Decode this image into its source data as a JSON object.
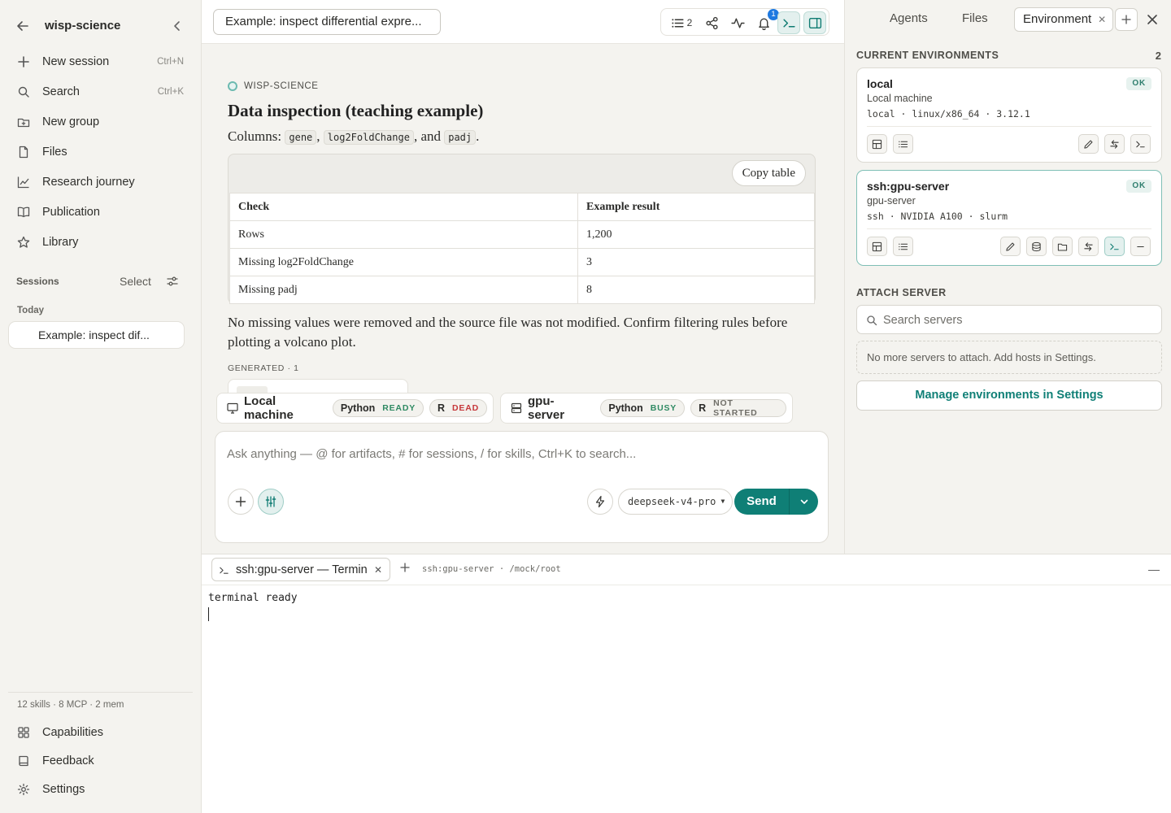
{
  "sidebar": {
    "title": "wisp-science",
    "nav": [
      {
        "label": "New session",
        "shortcut": "Ctrl+N",
        "icon": "plus-icon"
      },
      {
        "label": "Search",
        "shortcut": "Ctrl+K",
        "icon": "search-icon"
      },
      {
        "label": "New group",
        "icon": "folder-plus-icon"
      },
      {
        "label": "Files",
        "icon": "file-icon"
      },
      {
        "label": "Research journey",
        "icon": "trend-chart-icon"
      },
      {
        "label": "Publication",
        "icon": "book-open-icon"
      },
      {
        "label": "Library",
        "icon": "star-icon"
      }
    ],
    "sessions_header": "Sessions",
    "select_label": "Select",
    "today_label": "Today",
    "session_item": "Example: inspect dif...",
    "stats": "12 skills · 8 MCP · 2 mem",
    "footer": [
      {
        "label": "Capabilities",
        "icon": "grid-icon"
      },
      {
        "label": "Feedback",
        "icon": "book-icon"
      },
      {
        "label": "Settings",
        "icon": "gear-icon"
      }
    ]
  },
  "header": {
    "session_title": "Example: inspect differential expre...",
    "list_count": "2",
    "notification_count": "1"
  },
  "document": {
    "source": "WISP-SCIENCE",
    "title": "Data inspection (teaching example)",
    "columns_prefix": "Columns:",
    "col1": "gene",
    "col2": "log2FoldChange",
    "col3": "padj",
    "and_word": "and",
    "copy_label": "Copy table",
    "table": {
      "headers": [
        "Check",
        "Example result"
      ],
      "rows": [
        [
          "Rows",
          "1,200"
        ],
        [
          "Missing log2FoldChange",
          "3"
        ],
        [
          "Missing padj",
          "8"
        ]
      ]
    },
    "note": "No missing values were removed and the source file was not modified. Confirm filtering rules before plotting a volcano plot.",
    "generated": "GENERATED · 1"
  },
  "kernels": [
    {
      "name": "Local machine",
      "icon": "monitor-icon",
      "runtimes": [
        {
          "lang": "Python",
          "status": "READY",
          "cls": "ready"
        },
        {
          "lang": "R",
          "status": "DEAD",
          "cls": "dead"
        }
      ]
    },
    {
      "name": "gpu-server",
      "icon": "server-icon",
      "runtimes": [
        {
          "lang": "Python",
          "status": "BUSY",
          "cls": "busy"
        },
        {
          "lang": "R",
          "status": "NOT STARTED",
          "cls": "ns"
        }
      ]
    }
  ],
  "composer": {
    "placeholder": "Ask anything — @ for artifacts, # for sessions, / for skills, Ctrl+K to search...",
    "model": "deepseek-v4-pro",
    "send": "Send"
  },
  "right_panel": {
    "tabs": [
      "Agents",
      "Files",
      "Environment"
    ],
    "current_header": "CURRENT ENVIRONMENTS",
    "current_count": "2",
    "environments": [
      {
        "name": "local",
        "status": "OK",
        "subtitle": "Local machine",
        "details": "local · linux/x86_64 · 3.12.1"
      },
      {
        "name": "ssh:gpu-server",
        "status": "OK",
        "subtitle": "gpu-server",
        "details": "ssh · NVIDIA A100 · slurm"
      }
    ],
    "attach_header": "ATTACH SERVER",
    "search_placeholder": "Search servers",
    "no_more": "No more servers to attach. Add hosts in Settings.",
    "manage": "Manage environments in Settings"
  },
  "terminal": {
    "tab_label": "ssh:gpu-server — Terminal",
    "path": "ssh:gpu-server · /mock/root",
    "output": "terminal ready"
  },
  "colors": {
    "accent": "#0f7f76",
    "background": "#f4f3ef",
    "danger": "#c6383b",
    "success": "#2f8a63"
  }
}
